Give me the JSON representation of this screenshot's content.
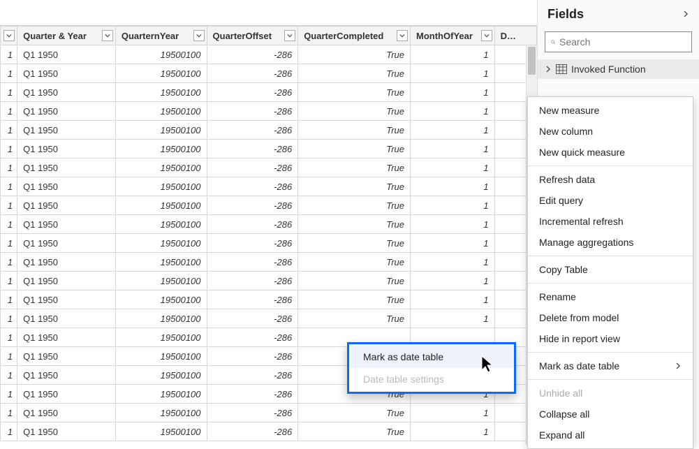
{
  "fields_pane": {
    "title": "Fields",
    "search_placeholder": "Search",
    "table_item": "Invoked Function"
  },
  "table": {
    "columns": [
      "",
      "Quarter & Year",
      "QuarternYear",
      "QuarterOffset",
      "QuarterCompleted",
      "MonthOfYear",
      "DayOf"
    ],
    "rows": [
      {
        "idx": "1",
        "qy": "Q1 1950",
        "qny": "19500100",
        "qoff": "-286",
        "qcomp": "True",
        "moy": "1"
      },
      {
        "idx": "1",
        "qy": "Q1 1950",
        "qny": "19500100",
        "qoff": "-286",
        "qcomp": "True",
        "moy": "1"
      },
      {
        "idx": "1",
        "qy": "Q1 1950",
        "qny": "19500100",
        "qoff": "-286",
        "qcomp": "True",
        "moy": "1"
      },
      {
        "idx": "1",
        "qy": "Q1 1950",
        "qny": "19500100",
        "qoff": "-286",
        "qcomp": "True",
        "moy": "1"
      },
      {
        "idx": "1",
        "qy": "Q1 1950",
        "qny": "19500100",
        "qoff": "-286",
        "qcomp": "True",
        "moy": "1"
      },
      {
        "idx": "1",
        "qy": "Q1 1950",
        "qny": "19500100",
        "qoff": "-286",
        "qcomp": "True",
        "moy": "1"
      },
      {
        "idx": "1",
        "qy": "Q1 1950",
        "qny": "19500100",
        "qoff": "-286",
        "qcomp": "True",
        "moy": "1"
      },
      {
        "idx": "1",
        "qy": "Q1 1950",
        "qny": "19500100",
        "qoff": "-286",
        "qcomp": "True",
        "moy": "1"
      },
      {
        "idx": "1",
        "qy": "Q1 1950",
        "qny": "19500100",
        "qoff": "-286",
        "qcomp": "True",
        "moy": "1"
      },
      {
        "idx": "1",
        "qy": "Q1 1950",
        "qny": "19500100",
        "qoff": "-286",
        "qcomp": "True",
        "moy": "1"
      },
      {
        "idx": "1",
        "qy": "Q1 1950",
        "qny": "19500100",
        "qoff": "-286",
        "qcomp": "True",
        "moy": "1"
      },
      {
        "idx": "1",
        "qy": "Q1 1950",
        "qny": "19500100",
        "qoff": "-286",
        "qcomp": "True",
        "moy": "1"
      },
      {
        "idx": "1",
        "qy": "Q1 1950",
        "qny": "19500100",
        "qoff": "-286",
        "qcomp": "True",
        "moy": "1"
      },
      {
        "idx": "1",
        "qy": "Q1 1950",
        "qny": "19500100",
        "qoff": "-286",
        "qcomp": "True",
        "moy": "1"
      },
      {
        "idx": "1",
        "qy": "Q1 1950",
        "qny": "19500100",
        "qoff": "-286",
        "qcomp": "True",
        "moy": "1"
      },
      {
        "idx": "1",
        "qy": "Q1 1950",
        "qny": "19500100",
        "qoff": "-286",
        "qcomp": "",
        "moy": ""
      },
      {
        "idx": "1",
        "qy": "Q1 1950",
        "qny": "19500100",
        "qoff": "-286",
        "qcomp": "",
        "moy": ""
      },
      {
        "idx": "1",
        "qy": "Q1 1950",
        "qny": "19500100",
        "qoff": "-286",
        "qcomp": "",
        "moy": ""
      },
      {
        "idx": "1",
        "qy": "Q1 1950",
        "qny": "19500100",
        "qoff": "-286",
        "qcomp": "True",
        "moy": "1"
      },
      {
        "idx": "1",
        "qy": "Q1 1950",
        "qny": "19500100",
        "qoff": "-286",
        "qcomp": "True",
        "moy": "1"
      },
      {
        "idx": "1",
        "qy": "Q1 1950",
        "qny": "19500100",
        "qoff": "-286",
        "qcomp": "True",
        "moy": "1"
      }
    ]
  },
  "context_menu": {
    "items": [
      {
        "label": "New measure"
      },
      {
        "label": "New column"
      },
      {
        "label": "New quick measure"
      },
      {
        "sep": true
      },
      {
        "label": "Refresh data"
      },
      {
        "label": "Edit query"
      },
      {
        "label": "Incremental refresh"
      },
      {
        "label": "Manage aggregations"
      },
      {
        "sep": true
      },
      {
        "label": "Copy Table"
      },
      {
        "sep": true
      },
      {
        "label": "Rename"
      },
      {
        "label": "Delete from model"
      },
      {
        "label": "Hide in report view"
      },
      {
        "sep": true
      },
      {
        "label": "Mark as date table",
        "submenu": true
      },
      {
        "sep": true
      },
      {
        "label": "Unhide all",
        "disabled": true
      },
      {
        "label": "Collapse all"
      },
      {
        "label": "Expand all"
      }
    ]
  },
  "submenu": {
    "items": [
      {
        "label": "Mark as date table",
        "hover": true
      },
      {
        "label": "Date table settings",
        "disabled": true
      }
    ]
  }
}
